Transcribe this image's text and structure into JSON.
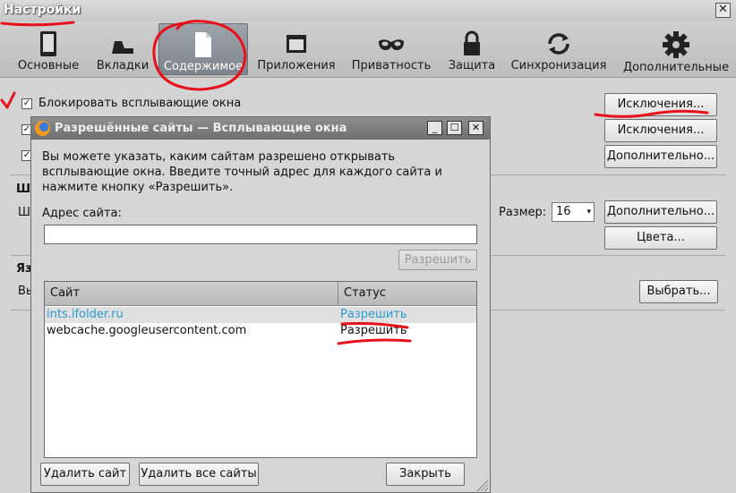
{
  "window": {
    "title": "Настройки",
    "close_glyph": "✕"
  },
  "toolbar": {
    "tabs": [
      {
        "id": "general",
        "label": "Основные",
        "icon": "device-icon"
      },
      {
        "id": "tabs",
        "label": "Вкладки",
        "icon": "tabs-icon"
      },
      {
        "id": "content",
        "label": "Содержимое",
        "icon": "document-icon",
        "active": true
      },
      {
        "id": "applications",
        "label": "Приложения",
        "icon": "window-icon"
      },
      {
        "id": "privacy",
        "label": "Приватность",
        "icon": "mask-icon"
      },
      {
        "id": "security",
        "label": "Защита",
        "icon": "lock-icon"
      },
      {
        "id": "sync",
        "label": "Синхронизация",
        "icon": "sync-icon"
      },
      {
        "id": "advanced",
        "label": "Дополнительные",
        "icon": "gear-icon"
      }
    ]
  },
  "content": {
    "block_popups_label": "Блокировать всплывающие окна",
    "checkmark": "✓",
    "exceptions_button_1": "Исключения...",
    "exceptions_button_2": "Исключения...",
    "advanced_button_1": "Дополнительно...",
    "fonts_heading_fragment": "Ш",
    "font_row_fragment": "Ш",
    "size_label": "Размер:",
    "size_value": "16",
    "size_arrow": "▾",
    "advanced_button_2": "Дополнительно...",
    "colors_button": "Цвета...",
    "languages_heading_fragment": "Яз",
    "languages_row_fragment": "Вы",
    "choose_button": "Выбрать..."
  },
  "dialog": {
    "title": "Разрешённые сайты — Всплывающие окна",
    "minimize_glyph": "_",
    "maximize_glyph": "☐",
    "close_glyph": "✕",
    "description": "Вы можете указать, каким сайтам разрешено открывать всплывающие окна. Введите точный адрес для каждого сайта и нажмите кнопку «Разрешить».",
    "address_label": "Адрес сайта:",
    "address_value": "",
    "allow_button": "Разрешить",
    "columns": {
      "site": "Сайт",
      "status": "Статус"
    },
    "rows": [
      {
        "site": "ints.ifolder.ru",
        "status": "Разрешить",
        "selected": true
      },
      {
        "site": "webcache.googleusercontent.com",
        "status": "Разрешить",
        "selected": false
      }
    ],
    "remove_site_button": "Удалить сайт",
    "remove_all_button": "Удалить все сайты",
    "close_button": "Закрыть"
  },
  "colors": {
    "active_tab": "#8a9098",
    "selected_link": "#2a9ad0",
    "dialog_title_bg": "#7a7a7a",
    "annotation_red": "#e8101a"
  }
}
